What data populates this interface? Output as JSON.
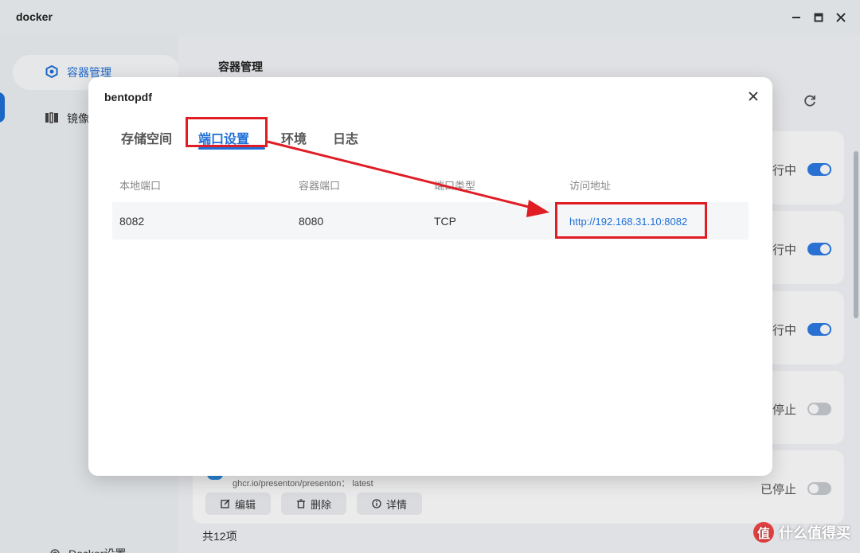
{
  "window": {
    "title": "docker",
    "minimize": "—",
    "maximize": "□",
    "close": "✕"
  },
  "sidebar": {
    "items": [
      {
        "label": "容器管理",
        "icon": "hexagon-icon",
        "active": true
      },
      {
        "label": "镜像",
        "icon": "image-icon",
        "active": false
      }
    ],
    "settings_label": "Docker设置"
  },
  "main": {
    "title": "容器管理",
    "containers": [
      {
        "status": "行中",
        "running": true
      },
      {
        "status": "行中",
        "running": true
      },
      {
        "status": "行中",
        "running": true
      },
      {
        "status": "停止",
        "running": false
      },
      {
        "status": "已停止",
        "running": false,
        "image": "ghcr.io/presenton/presenton： latest"
      }
    ],
    "actions": {
      "edit": "编辑",
      "delete": "删除",
      "details": "详情"
    },
    "count": "共12项"
  },
  "dialog": {
    "title": "bentopdf",
    "tabs": [
      "存储空间",
      "端口设置",
      "环境",
      "日志"
    ],
    "active_tab": "端口设置",
    "columns": [
      "本地端口",
      "容器端口",
      "端口类型",
      "访问地址"
    ],
    "rows": [
      {
        "local_port": "8082",
        "container_port": "8080",
        "type": "TCP",
        "address": "http://192.168.31.10:8082"
      }
    ]
  },
  "watermark": {
    "badge": "值",
    "text": "什么值得买"
  },
  "colors": {
    "accent": "#1f6fd6",
    "highlight": "#e01c24",
    "toggle_on": "#2c7be5",
    "toggle_off": "#c8ccd2"
  }
}
